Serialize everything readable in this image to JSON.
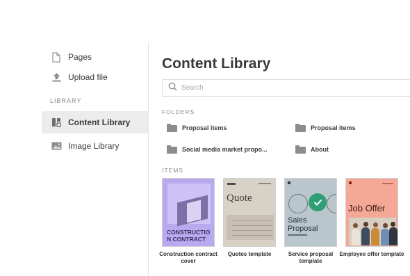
{
  "sidebar": {
    "items": [
      {
        "label": "Pages",
        "icon": "page-icon"
      },
      {
        "label": "Upload file",
        "icon": "upload-icon"
      }
    ],
    "section_label": "LIBRARY",
    "library_items": [
      {
        "label": "Content Library",
        "icon": "content-library-icon",
        "active": true
      },
      {
        "label": "Image Library",
        "icon": "image-icon",
        "active": false
      }
    ]
  },
  "main": {
    "title": "Content Library",
    "search": {
      "placeholder": "Search"
    },
    "folders_label": "FOLDERS",
    "folders": [
      {
        "label": "Proposal items"
      },
      {
        "label": "Proposal items"
      },
      {
        "label": "Social media market propo..."
      },
      {
        "label": "About"
      }
    ],
    "items_label": "ITEMS",
    "items": [
      {
        "caption": "Construction contract cover",
        "thumb_text": "CONSTRUCTIO N CONTRACT"
      },
      {
        "caption": "Quotes template",
        "thumb_text": "Quote"
      },
      {
        "caption": "Service proposal template",
        "thumb_text": "Sales Proposal",
        "selected": true
      },
      {
        "caption": "Employee offer template",
        "thumb_text": "Job Offer"
      }
    ]
  },
  "colors": {
    "active_bg": "#ececec",
    "check_green": "#2f9e74",
    "card_purple": "#b9a9ef",
    "card_beige": "#d8d2c6",
    "card_blue": "#b9c7cc",
    "card_pink": "#f5a896"
  }
}
